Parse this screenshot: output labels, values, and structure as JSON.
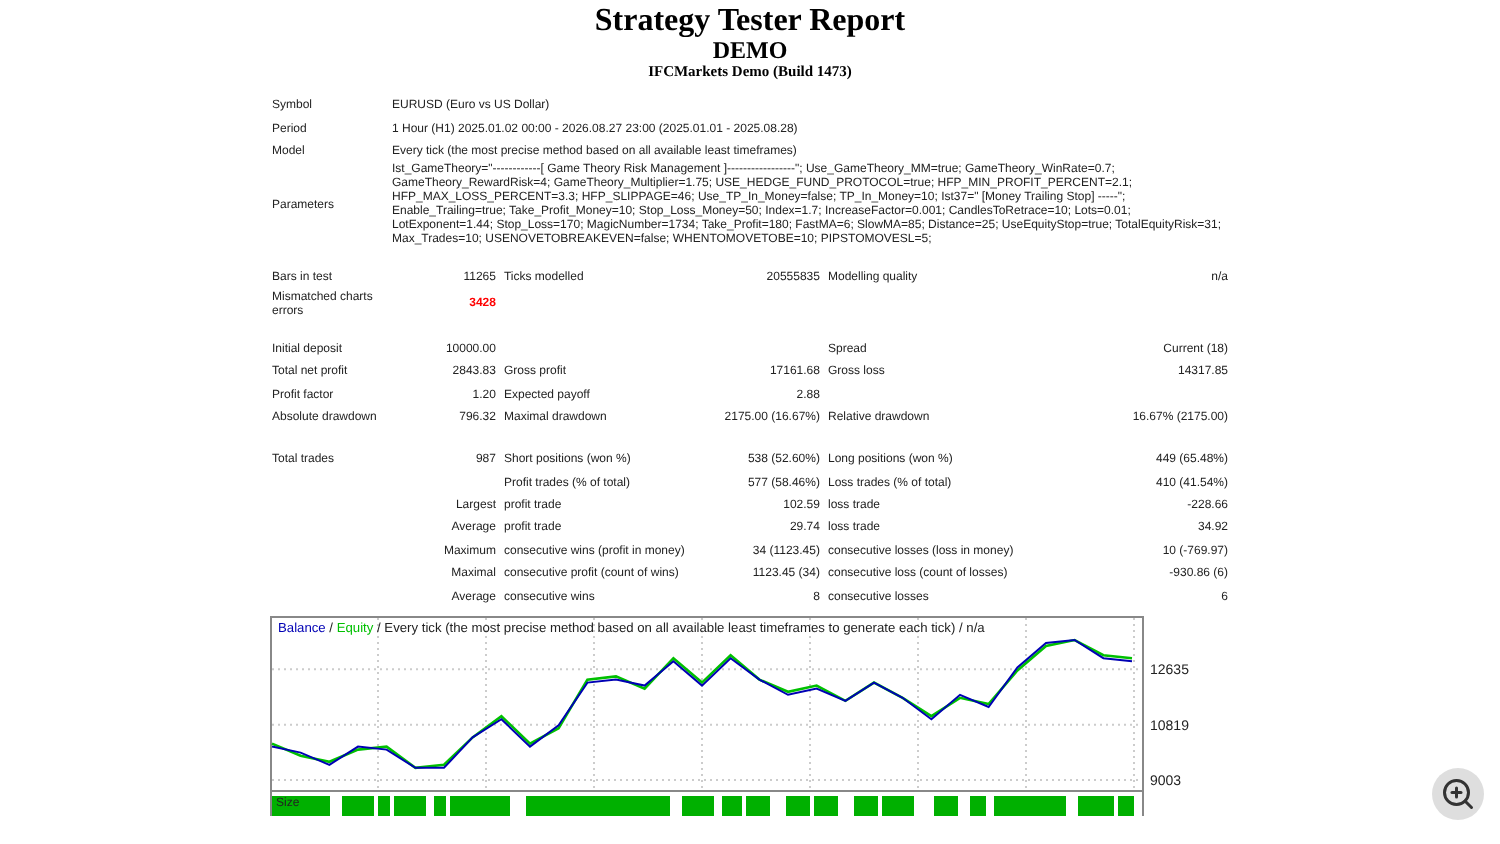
{
  "report": {
    "title": "Strategy Tester Report",
    "subtitle": "DEMO",
    "server": "IFCMarkets Demo (Build 1473)"
  },
  "info": [
    {
      "label": "Symbol",
      "value": "EURUSD (Euro vs US Dollar)"
    },
    {
      "label": "Period",
      "value": "1 Hour (H1) 2025.01.02 00:00 - 2026.08.27 23:00 (2025.01.01 - 2025.08.28)"
    },
    {
      "label": "Model",
      "value": "Every tick (the most precise method based on all available least timeframes)"
    },
    {
      "label": "Parameters",
      "value": "Ist_GameTheory=\"------------[ Game Theory Risk Management ]-----------------\"; Use_GameTheory_MM=true; GameTheory_WinRate=0.7; GameTheory_RewardRisk=4; GameTheory_Multiplier=1.75; USE_HEDGE_FUND_PROTOCOL=true; HFP_MIN_PROFIT_PERCENT=2.1; HFP_MAX_LOSS_PERCENT=3.3; HFP_SLIPPAGE=46; Use_TP_In_Money=false; TP_In_Money=10; Ist37=\"                [Money Trailing Stop] -----\"; Enable_Trailing=true; Take_Profit_Money=10; Stop_Loss_Money=50; Index=1.7; IncreaseFactor=0.001; CandlesToRetrace=10; Lots=0.01; LotExponent=1.44; Stop_Loss=170; MagicNumber=1734; Take_Profit=180; FastMA=6; SlowMA=85; Distance=25; UseEquityStop=true; TotalEquityRisk=31; Max_Trades=10; USENOVETOBREAKEVEN=false; WHENTOMOVETOBE=10; PIPSTOMOVESL=5;"
    }
  ],
  "stats": [
    [
      {
        "kind": "main",
        "cells": [
          "Bars in test",
          "11265",
          "Ticks modelled",
          "20555835",
          "Modelling quality",
          "n/a"
        ]
      },
      {
        "kind": "alert",
        "cells": [
          "Mismatched charts errors",
          "3428",
          null,
          null,
          null,
          null
        ]
      }
    ],
    [
      {
        "kind": "main",
        "cells": [
          "Initial deposit",
          "10000.00",
          null,
          null,
          "Spread",
          "Current (18)"
        ]
      },
      {
        "kind": "main",
        "cells": [
          "Total net profit",
          "2843.83",
          "Gross profit",
          "17161.68",
          "Gross loss",
          "14317.85"
        ]
      },
      {
        "kind": "main",
        "cells": [
          "Profit factor",
          "1.20",
          "Expected payoff",
          "2.88",
          null,
          null
        ]
      },
      {
        "kind": "main",
        "cells": [
          "Absolute drawdown",
          "796.32",
          "Maximal drawdown",
          "2175.00 (16.67%)",
          "Relative drawdown",
          "16.67% (2175.00)"
        ]
      }
    ],
    [
      {
        "kind": "main",
        "cells": [
          "Total trades",
          "987",
          "Short positions (won %)",
          "538 (52.60%)",
          "Long positions (won %)",
          "449 (65.48%)"
        ]
      },
      {
        "kind": "sub",
        "cells": [
          null,
          "Profit trades (% of total)",
          "577 (58.46%)",
          "Loss trades (% of total)",
          "410 (41.54%)"
        ]
      },
      {
        "kind": "sub",
        "cells": [
          "Largest",
          "profit trade",
          "102.59",
          "loss trade",
          "-228.66"
        ]
      },
      {
        "kind": "sub",
        "cells": [
          "Average",
          "profit trade",
          "29.74",
          "loss trade",
          "34.92"
        ]
      },
      {
        "kind": "sub",
        "cells": [
          "Maximum",
          "consecutive wins (profit in money)",
          "34 (1123.45)",
          "consecutive losses (loss in money)",
          "10 (-769.97)"
        ]
      },
      {
        "kind": "sub",
        "cells": [
          "Maximal",
          "consecutive profit (count of wins)",
          "1123.45 (34)",
          "consecutive loss (count of losses)",
          "-930.86 (6)"
        ]
      },
      {
        "kind": "sub",
        "cells": [
          "Average",
          "consecutive wins",
          "8",
          "consecutive losses",
          "6"
        ]
      }
    ]
  ],
  "chart": {
    "legend_separator": "/",
    "volume_label": "Size",
    "chart_data": {
      "type": "line",
      "grid": true,
      "title": "Every tick (the most precise method based on all available least timeframes to generate each tick) / n/a",
      "ylim": [
        8740,
        14320
      ],
      "yticks": [
        9003,
        10819,
        12635
      ],
      "series": [
        {
          "name": "Balance",
          "color": "#0000b4",
          "values": [
            10100,
            9900,
            9500,
            10100,
            10000,
            9400,
            9400,
            10400,
            11000,
            10100,
            10800,
            12200,
            12300,
            12100,
            12900,
            12100,
            13000,
            12300,
            11800,
            12000,
            11600,
            12200,
            11700,
            11000,
            11800,
            11400,
            12700,
            13500,
            13600,
            13000,
            12900
          ]
        },
        {
          "name": "Equity",
          "color": "#00c000",
          "values": [
            10200,
            9800,
            9600,
            10000,
            10100,
            9400,
            9500,
            10400,
            11100,
            10200,
            10700,
            12300,
            12400,
            12000,
            13000,
            12200,
            13100,
            12300,
            11900,
            12100,
            11600,
            12200,
            11700,
            11100,
            11700,
            11500,
            12600,
            13400,
            13600,
            13100,
            13000
          ]
        }
      ]
    }
  }
}
